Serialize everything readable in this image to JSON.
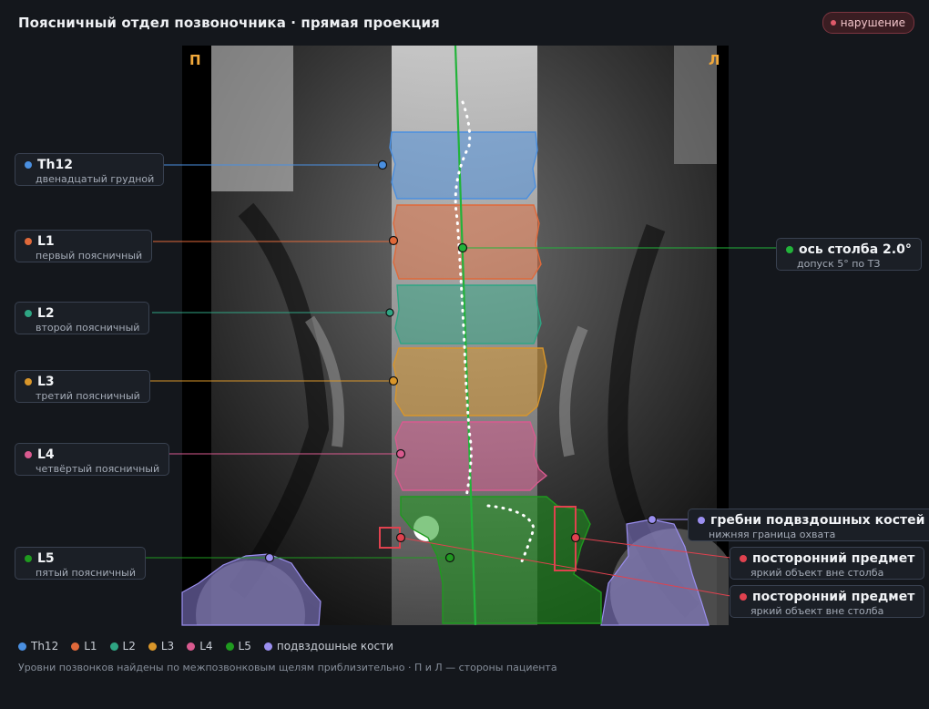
{
  "header": {
    "title": "Поясничный отдел позвоночника · прямая проекция",
    "badge": "нарушение"
  },
  "image": {
    "side_right": "П",
    "side_left": "Л"
  },
  "colors": {
    "th12": "#4a8fe0",
    "l1": "#e0693a",
    "l2": "#2fa583",
    "l3": "#d9962a",
    "l4": "#d95a8f",
    "l5": "#1f9a1f",
    "iliac": "#9b8ff0",
    "foreign": "#e0424f",
    "axis": "#22b33a"
  },
  "labels": {
    "th12": {
      "name": "Th12",
      "desc": "двенадцатый грудной"
    },
    "l1": {
      "name": "L1",
      "desc": "первый поясничный"
    },
    "l2": {
      "name": "L2",
      "desc": "второй поясничный"
    },
    "l3": {
      "name": "L3",
      "desc": "третий поясничный"
    },
    "l4": {
      "name": "L4",
      "desc": "четвёртый поясничный"
    },
    "l5": {
      "name": "L5",
      "desc": "пятый поясничный"
    },
    "axis": {
      "name": "ось столба 2.0°",
      "desc": "допуск 5° по ТЗ"
    },
    "iliac": {
      "name": "гребни подвздошных костей",
      "desc": "нижняя граница охвата"
    },
    "foreign1": {
      "name": "посторонний предмет",
      "desc": "яркий объект вне столба"
    },
    "foreign2": {
      "name": "посторонний предмет",
      "desc": "яркий объект вне столба"
    }
  },
  "legend": [
    "Th12",
    "L1",
    "L2",
    "L3",
    "L4",
    "L5",
    "подвздошные кости"
  ],
  "footer": "Уровни позвонков найдены по межпозвонковым щелям приблизительно · П и Л — стороны пациента"
}
